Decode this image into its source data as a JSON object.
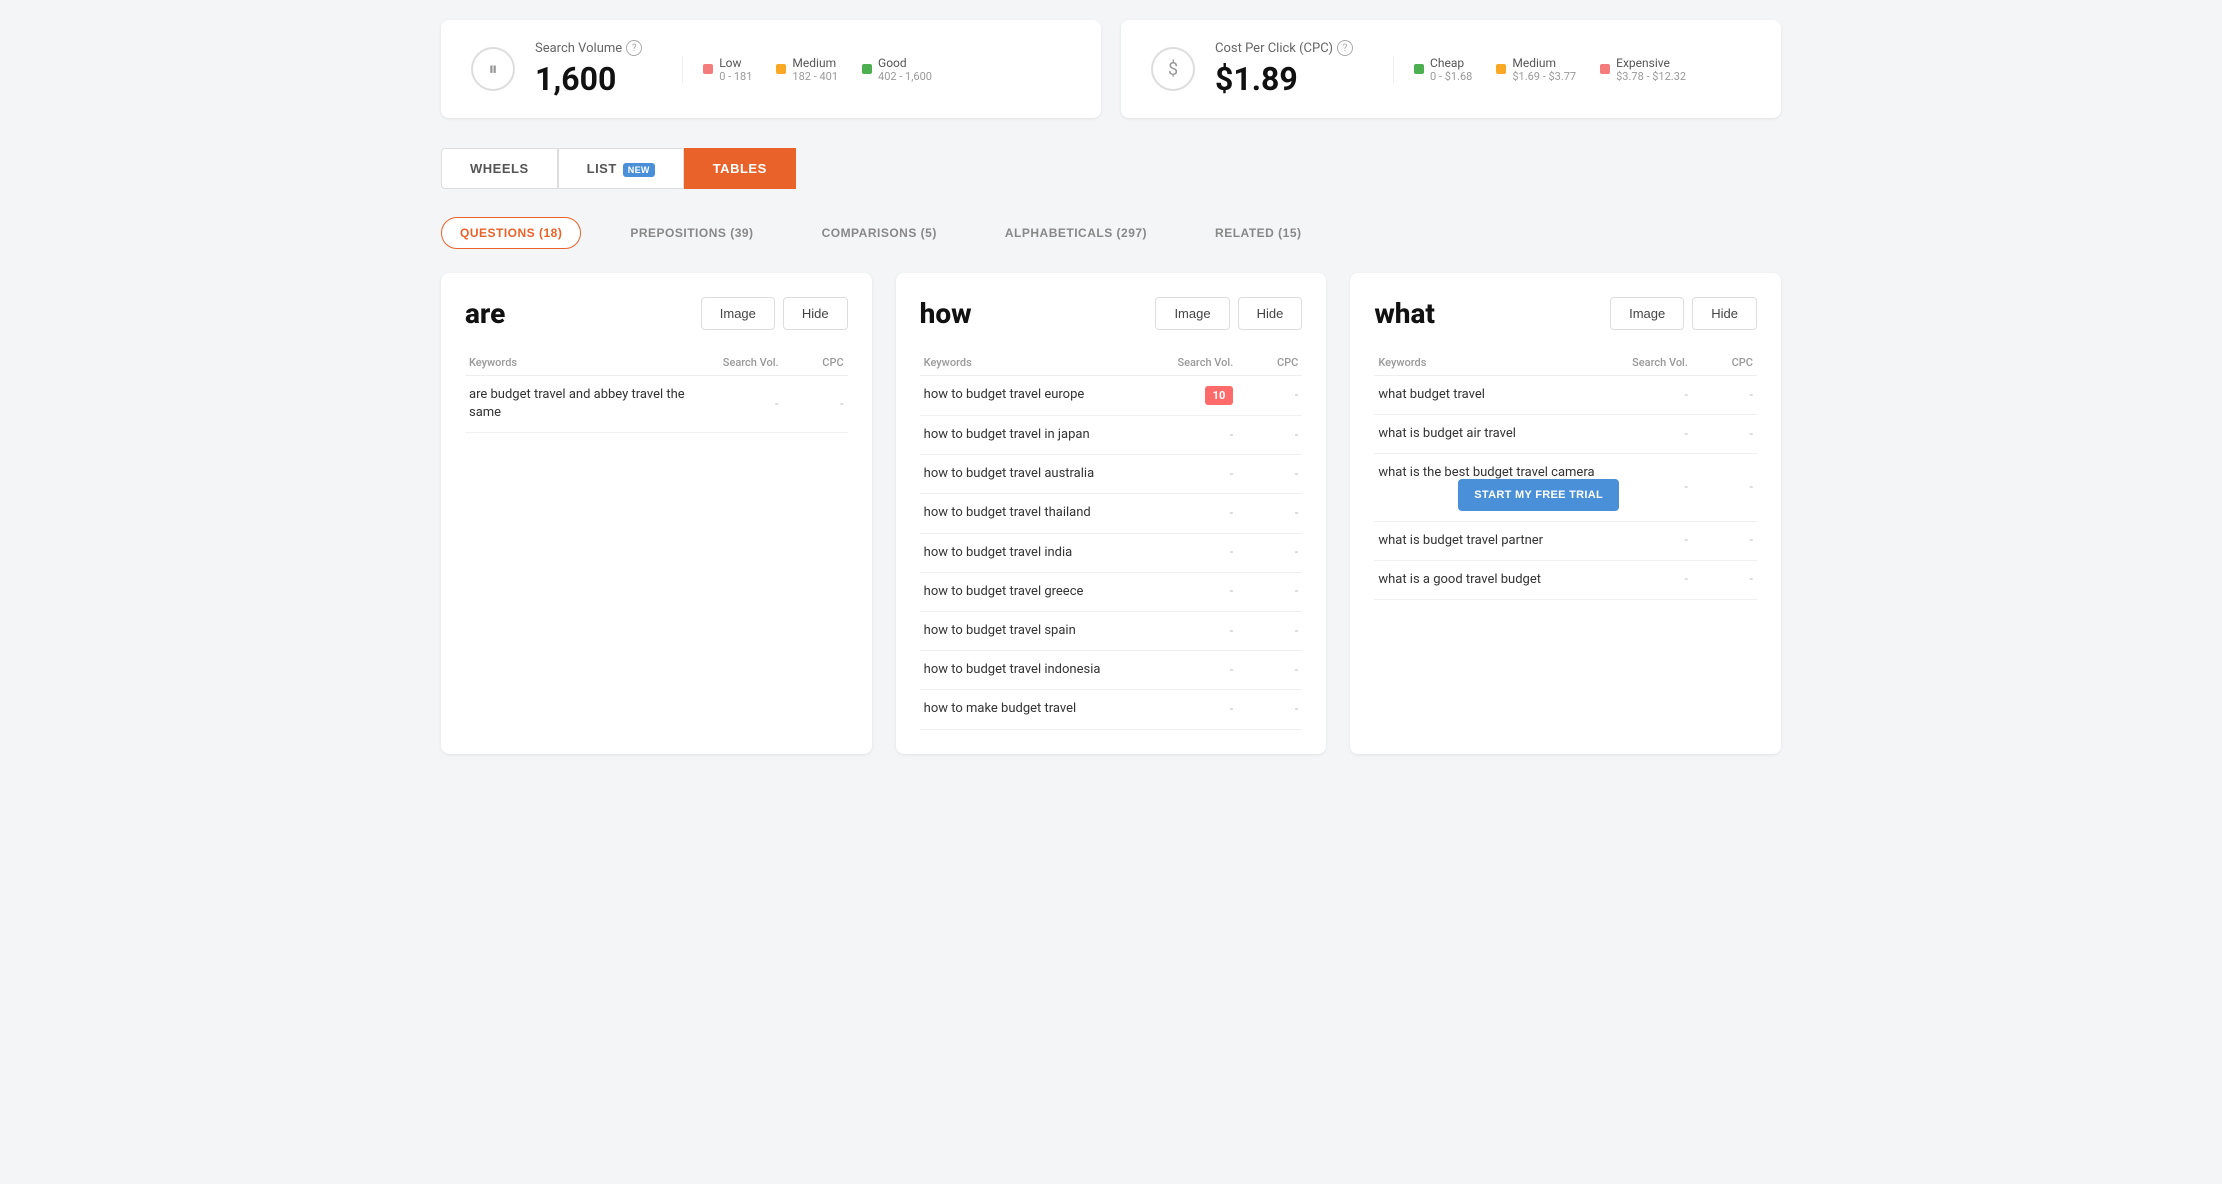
{
  "stats": {
    "search_volume": {
      "label": "Search Volume",
      "value": "1,600",
      "legend": [
        {
          "color": "#f47c7c",
          "name": "Low",
          "range": "0 - 181"
        },
        {
          "color": "#f9a825",
          "name": "Medium",
          "range": "182 - 401"
        },
        {
          "color": "#4caf50",
          "name": "Good",
          "range": "402 - 1,600"
        }
      ]
    },
    "cpc": {
      "label": "Cost Per Click (CPC)",
      "value": "$1.89",
      "legend": [
        {
          "color": "#4caf50",
          "name": "Cheap",
          "range": "0 - $1.68"
        },
        {
          "color": "#f9a825",
          "name": "Medium",
          "range": "$1.69 - $3.77"
        },
        {
          "color": "#f47c7c",
          "name": "Expensive",
          "range": "$3.78 - $12.32"
        }
      ]
    }
  },
  "tabs": [
    {
      "id": "wheels",
      "label": "WHEELS",
      "active": false
    },
    {
      "id": "list",
      "label": "LIST",
      "badge": "NEW",
      "active": false
    },
    {
      "id": "tables",
      "label": "TABLES",
      "active": true
    }
  ],
  "filters": [
    {
      "id": "questions",
      "label": "QUESTIONS (18)",
      "active": true
    },
    {
      "id": "prepositions",
      "label": "PREPOSITIONS (39)",
      "active": false
    },
    {
      "id": "comparisons",
      "label": "COMPARISONS (5)",
      "active": false
    },
    {
      "id": "alphabeticals",
      "label": "ALPHABETICALS (297)",
      "active": false
    },
    {
      "id": "related",
      "label": "RELATED (15)",
      "active": false
    }
  ],
  "columns": [
    {
      "word": "are",
      "image_btn": "Image",
      "hide_btn": "Hide",
      "headers": {
        "keyword": "Keywords",
        "vol": "Search Vol.",
        "cpc": "CPC"
      },
      "rows": [
        {
          "keyword": "are budget travel and abbey travel the same",
          "vol": "-",
          "cpc": "-",
          "vol_badge": false
        }
      ]
    },
    {
      "word": "how",
      "image_btn": "Image",
      "hide_btn": "Hide",
      "headers": {
        "keyword": "Keywords",
        "vol": "Search Vol.",
        "cpc": "CPC"
      },
      "rows": [
        {
          "keyword": "how to budget travel europe",
          "vol": "10",
          "cpc": "-",
          "vol_badge": true
        },
        {
          "keyword": "how to budget travel in japan",
          "vol": "-",
          "cpc": "-",
          "vol_badge": false
        },
        {
          "keyword": "how to budget travel australia",
          "vol": "-",
          "cpc": "-",
          "vol_badge": false
        },
        {
          "keyword": "how to budget travel thailand",
          "vol": "-",
          "cpc": "-",
          "vol_badge": false
        },
        {
          "keyword": "how to budget travel india",
          "vol": "-",
          "cpc": "-",
          "vol_badge": false
        },
        {
          "keyword": "how to budget travel greece",
          "vol": "-",
          "cpc": "-",
          "vol_badge": false
        },
        {
          "keyword": "how to budget travel spain",
          "vol": "-",
          "cpc": "-",
          "vol_badge": false
        },
        {
          "keyword": "how to budget travel indonesia",
          "vol": "-",
          "cpc": "-",
          "vol_badge": false
        },
        {
          "keyword": "how to make budget travel",
          "vol": "-",
          "cpc": "-",
          "vol_badge": false
        }
      ]
    },
    {
      "word": "what",
      "image_btn": "Image",
      "hide_btn": "Hide",
      "headers": {
        "keyword": "Keywords",
        "vol": "Search Vol.",
        "cpc": "CPC"
      },
      "rows": [
        {
          "keyword": "what budget travel",
          "vol": "-",
          "cpc": "-",
          "vol_badge": false
        },
        {
          "keyword": "what is budget air travel",
          "vol": "-",
          "cpc": "-",
          "vol_badge": false
        },
        {
          "keyword": "what is the best budget travel camera",
          "vol": "-",
          "cpc": "-",
          "vol_badge": false,
          "cta": true
        },
        {
          "keyword": "what is budget travel partner",
          "vol": "-",
          "cpc": "-",
          "vol_badge": false
        },
        {
          "keyword": "what is a good travel budget",
          "vol": "-",
          "cpc": "-",
          "vol_badge": false
        }
      ]
    }
  ],
  "cta": {
    "label": "START MY FREE TRIAL"
  }
}
